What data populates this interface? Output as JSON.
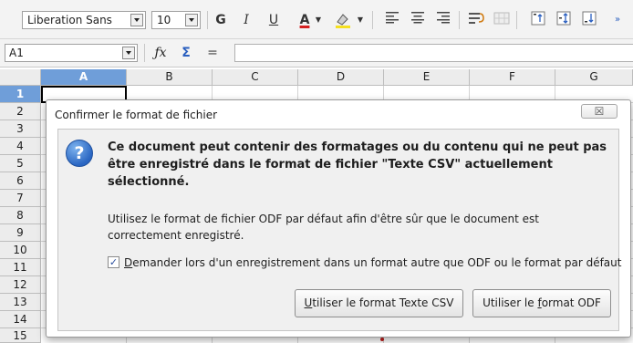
{
  "toolbar": {
    "font_name": "Liberation Sans",
    "font_size": "10",
    "bold": "G",
    "italic": "I",
    "underline": "U",
    "font_color": "A"
  },
  "formula_bar": {
    "cell_ref": "A1",
    "fx": "ƒx",
    "sum": "Σ",
    "equals": "="
  },
  "sheet": {
    "columns": [
      "A",
      "B",
      "C",
      "D",
      "E",
      "F",
      "G"
    ],
    "rows": [
      "1",
      "2",
      "3",
      "4",
      "5",
      "6",
      "7",
      "8",
      "9",
      "10",
      "11",
      "12",
      "13",
      "14",
      "15"
    ],
    "active_color": "#6f9ed9"
  },
  "dialog": {
    "title": "Confirmer le format de fichier",
    "close_symbol": "☒",
    "headline": "Ce document peut contenir des formatages ou du contenu qui ne peut pas être enregistré dans le format de fichier \"Texte CSV\" actuellement sélectionné.",
    "info": "Utilisez le format de fichier ODF par défaut afin d'être sûr que le document est correctement enregistré.",
    "checkbox": {
      "checked": true,
      "mark": "✓",
      "first_letter": "D",
      "rest": "emander lors d'un enregistrement dans un format autre que ODF ou le format par défaut"
    },
    "btn_csv": {
      "before": "",
      "key": "U",
      "after": "tiliser le format Texte CSV"
    },
    "btn_odf": {
      "before": "Utiliser le ",
      "key": "f",
      "after": "ormat ODF"
    }
  }
}
